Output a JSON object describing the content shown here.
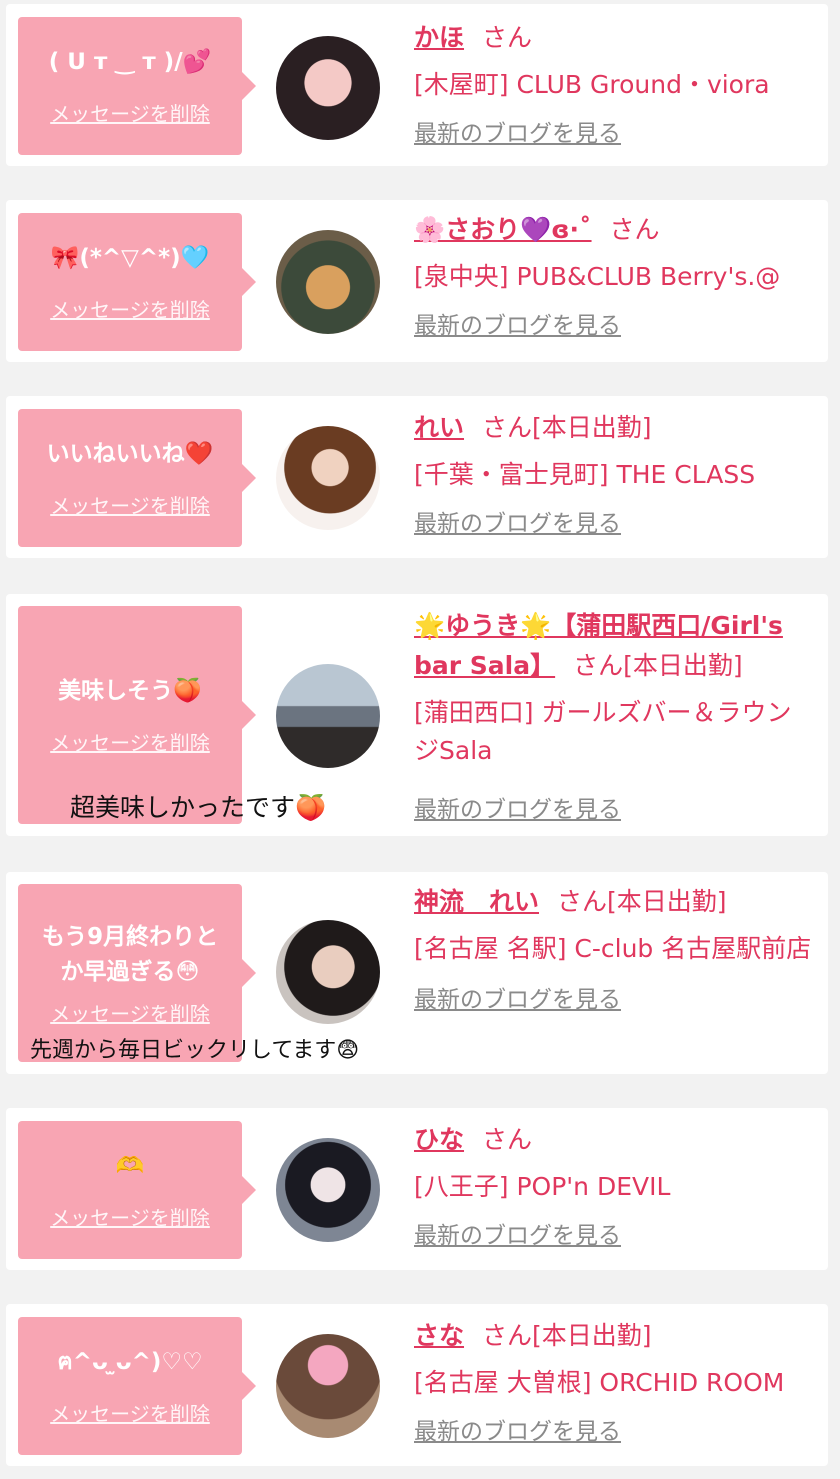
{
  "delete_label": "メッセージを削除",
  "blog_label": "最新のブログを見る",
  "san": "さん",
  "items": [
    {
      "message": "( ᑌ т ‿ т )/💕",
      "name": "かほ",
      "extra": "",
      "shop": "[木屋町] CLUB Ground・viora",
      "comment": ""
    },
    {
      "message": "🎀(*^▽^*)🩵",
      "name": "🌸さおり💜ɞ·˚",
      "extra": "",
      "shop": "[泉中央] PUB&CLUB Berry's.@",
      "comment": ""
    },
    {
      "message": "いいねいいね❤️",
      "name": "れい",
      "extra": "[本日出勤]",
      "shop": "[千葉・富士見町] THE CLASS",
      "comment": ""
    },
    {
      "message": "美味しそう🍑",
      "name": "🌟ゆうき🌟【蒲田駅西口/Girl's bar Sala】",
      "extra": "[本日出勤]",
      "shop": "[蒲田西口] ガールズバー＆ラウンジSala",
      "comment": "超美味しかったです🍑"
    },
    {
      "message": "もう9月終わりとか早過ぎる😳",
      "name": "神流　れい",
      "extra": "[本日出勤]",
      "shop": "[名古屋 名駅] C-club 名古屋駅前店",
      "comment": "先週から毎日ビックリしてます😨"
    },
    {
      "message": "🫶",
      "name": "ひな",
      "extra": "",
      "shop": "[八王子] POP'n DEVIL",
      "comment": ""
    },
    {
      "message": "ฅ^ᴗ ̫ᴗ^)♡♡",
      "name": "さな",
      "extra": "[本日出勤]",
      "shop": "[名古屋 大曽根] ORCHID ROOM",
      "comment": ""
    }
  ],
  "colors": {
    "bubble": "#f8a5b3",
    "accent": "#e0375e",
    "link_gray": "#8a8a8a",
    "background": "#f2f2f2"
  }
}
